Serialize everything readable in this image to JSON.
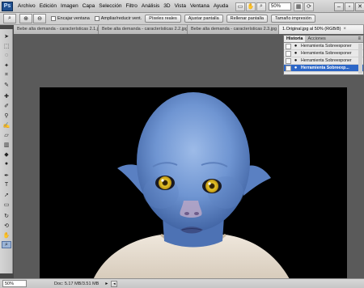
{
  "menu": [
    "Archivo",
    "Edición",
    "Imagen",
    "Capa",
    "Selección",
    "Filtro",
    "Análisis",
    "3D",
    "Vista",
    "Ventana",
    "Ayuda"
  ],
  "menubar_zoom": "50%",
  "options": {
    "checks": [
      "Encajar ventana",
      "Ampliar/reducir vent."
    ],
    "buttons": [
      "Píxeles reales",
      "Ajustar pantalla",
      "Rellenar pantalla",
      "Tamaño impresión"
    ]
  },
  "tabs": [
    "Bebe alta demanda - características 2.1.jpg",
    "Bebe alta demanda - características 2.2.jpg",
    "Bebe alta demanda - características 2.3.jpg",
    "1.Original.jpg al 50% (RGB/8)"
  ],
  "history": {
    "tabs": [
      "Historia",
      "Acciones"
    ],
    "items": [
      "Herramienta Sobreexponer",
      "Herramienta Sobreexponer",
      "Herramienta Sobreexponer",
      "Herramienta Sobreexp..."
    ]
  },
  "status": {
    "zoom": "50%",
    "doc": "Doc: 5.17 MB/3.51 MB"
  },
  "colors": {
    "skin": "#6f95d2",
    "eyes": "#e9c62a",
    "shirt": "#e7ddd0"
  }
}
